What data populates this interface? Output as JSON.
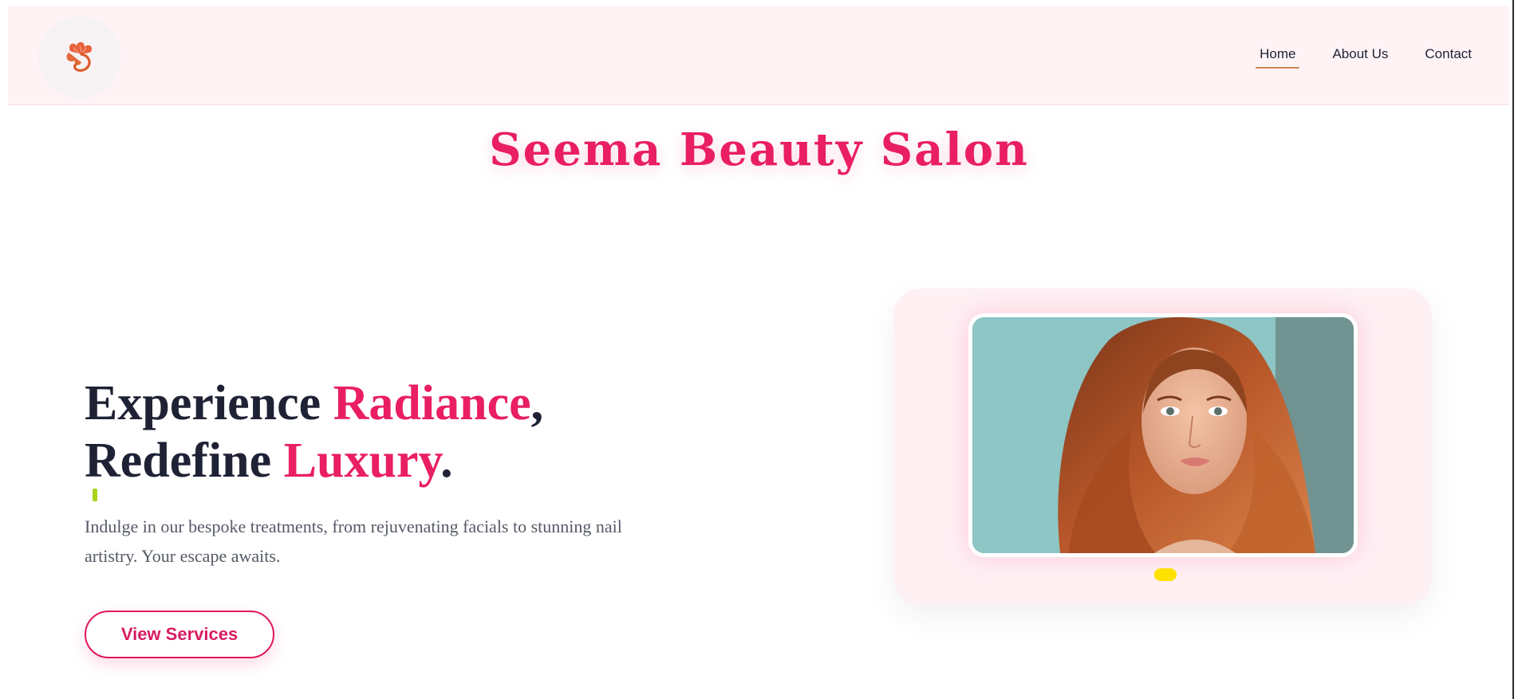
{
  "nav": {
    "logo": "flower-logo-icon",
    "links": [
      {
        "label": "Home",
        "active": true
      },
      {
        "label": "About Us",
        "active": false
      },
      {
        "label": "Contact",
        "active": false
      }
    ]
  },
  "brand": {
    "title": "Seema Beauty Salon"
  },
  "hero": {
    "heading": {
      "line1_part1": "Experience ",
      "line1_accent": "Radiance",
      "line1_end": ",",
      "line2_part1": "Redefine ",
      "line2_accent": "Luxury",
      "line2_end": "."
    },
    "subtitle": "Indulge in our bespoke treatments, from rejuvenating facials to stunning nail artistry. Your escape awaits.",
    "cta_label": "View Services"
  },
  "carousel": {
    "active_index": 0,
    "slide_count": 1
  },
  "colors": {
    "accent": "#e91e63",
    "dark_text": "#1f2235",
    "nav_bg": "#fff3f5",
    "card_bg": "#fff0f4",
    "dot": "#ffe100"
  }
}
